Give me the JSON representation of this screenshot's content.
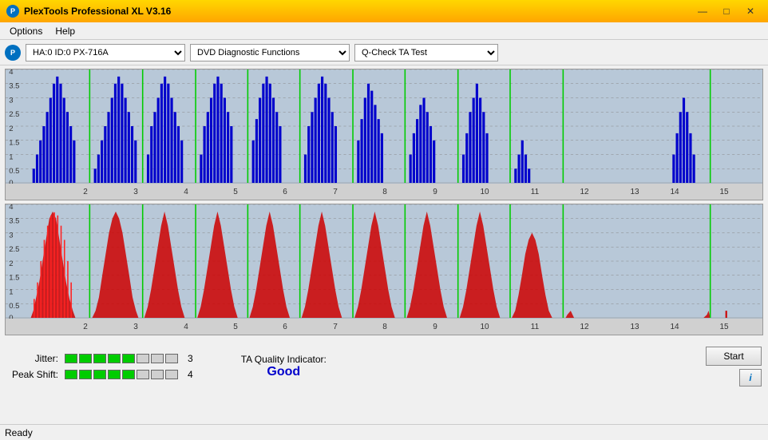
{
  "window": {
    "title": "PlexTools Professional XL V3.16",
    "logo_text": "P"
  },
  "title_controls": {
    "minimize": "—",
    "maximize": "□",
    "close": "✕"
  },
  "menu": {
    "items": [
      "Options",
      "Help"
    ]
  },
  "toolbar": {
    "drive_options": [
      "HA:0 ID:0  PX-716A"
    ],
    "drive_selected": "HA:0 ID:0  PX-716A",
    "function_options": [
      "DVD Diagnostic Functions"
    ],
    "function_selected": "DVD Diagnostic Functions",
    "test_options": [
      "Q-Check TA Test"
    ],
    "test_selected": "Q-Check TA Test"
  },
  "charts": {
    "top": {
      "color": "#0000cc",
      "y_max": 4,
      "y_labels": [
        "4",
        "3.5",
        "3",
        "2.5",
        "2",
        "1.5",
        "1",
        "0.5",
        "0"
      ],
      "x_labels": [
        "2",
        "3",
        "4",
        "5",
        "6",
        "7",
        "8",
        "9",
        "10",
        "11",
        "12",
        "13",
        "14",
        "15"
      ]
    },
    "bottom": {
      "color": "#cc0000",
      "y_max": 4,
      "y_labels": [
        "4",
        "3.5",
        "3",
        "2.5",
        "2",
        "1.5",
        "1",
        "0.5",
        "0"
      ],
      "x_labels": [
        "2",
        "3",
        "4",
        "5",
        "6",
        "7",
        "8",
        "9",
        "10",
        "11",
        "12",
        "13",
        "14",
        "15"
      ]
    }
  },
  "metrics": {
    "jitter": {
      "label": "Jitter:",
      "filled_segments": 5,
      "total_segments": 8,
      "value": "3"
    },
    "peak_shift": {
      "label": "Peak Shift:",
      "filled_segments": 5,
      "total_segments": 8,
      "value": "4"
    },
    "ta_quality": {
      "label": "TA Quality Indicator:",
      "value": "Good"
    }
  },
  "buttons": {
    "start": "Start",
    "info": "i"
  },
  "status": {
    "text": "Ready"
  }
}
